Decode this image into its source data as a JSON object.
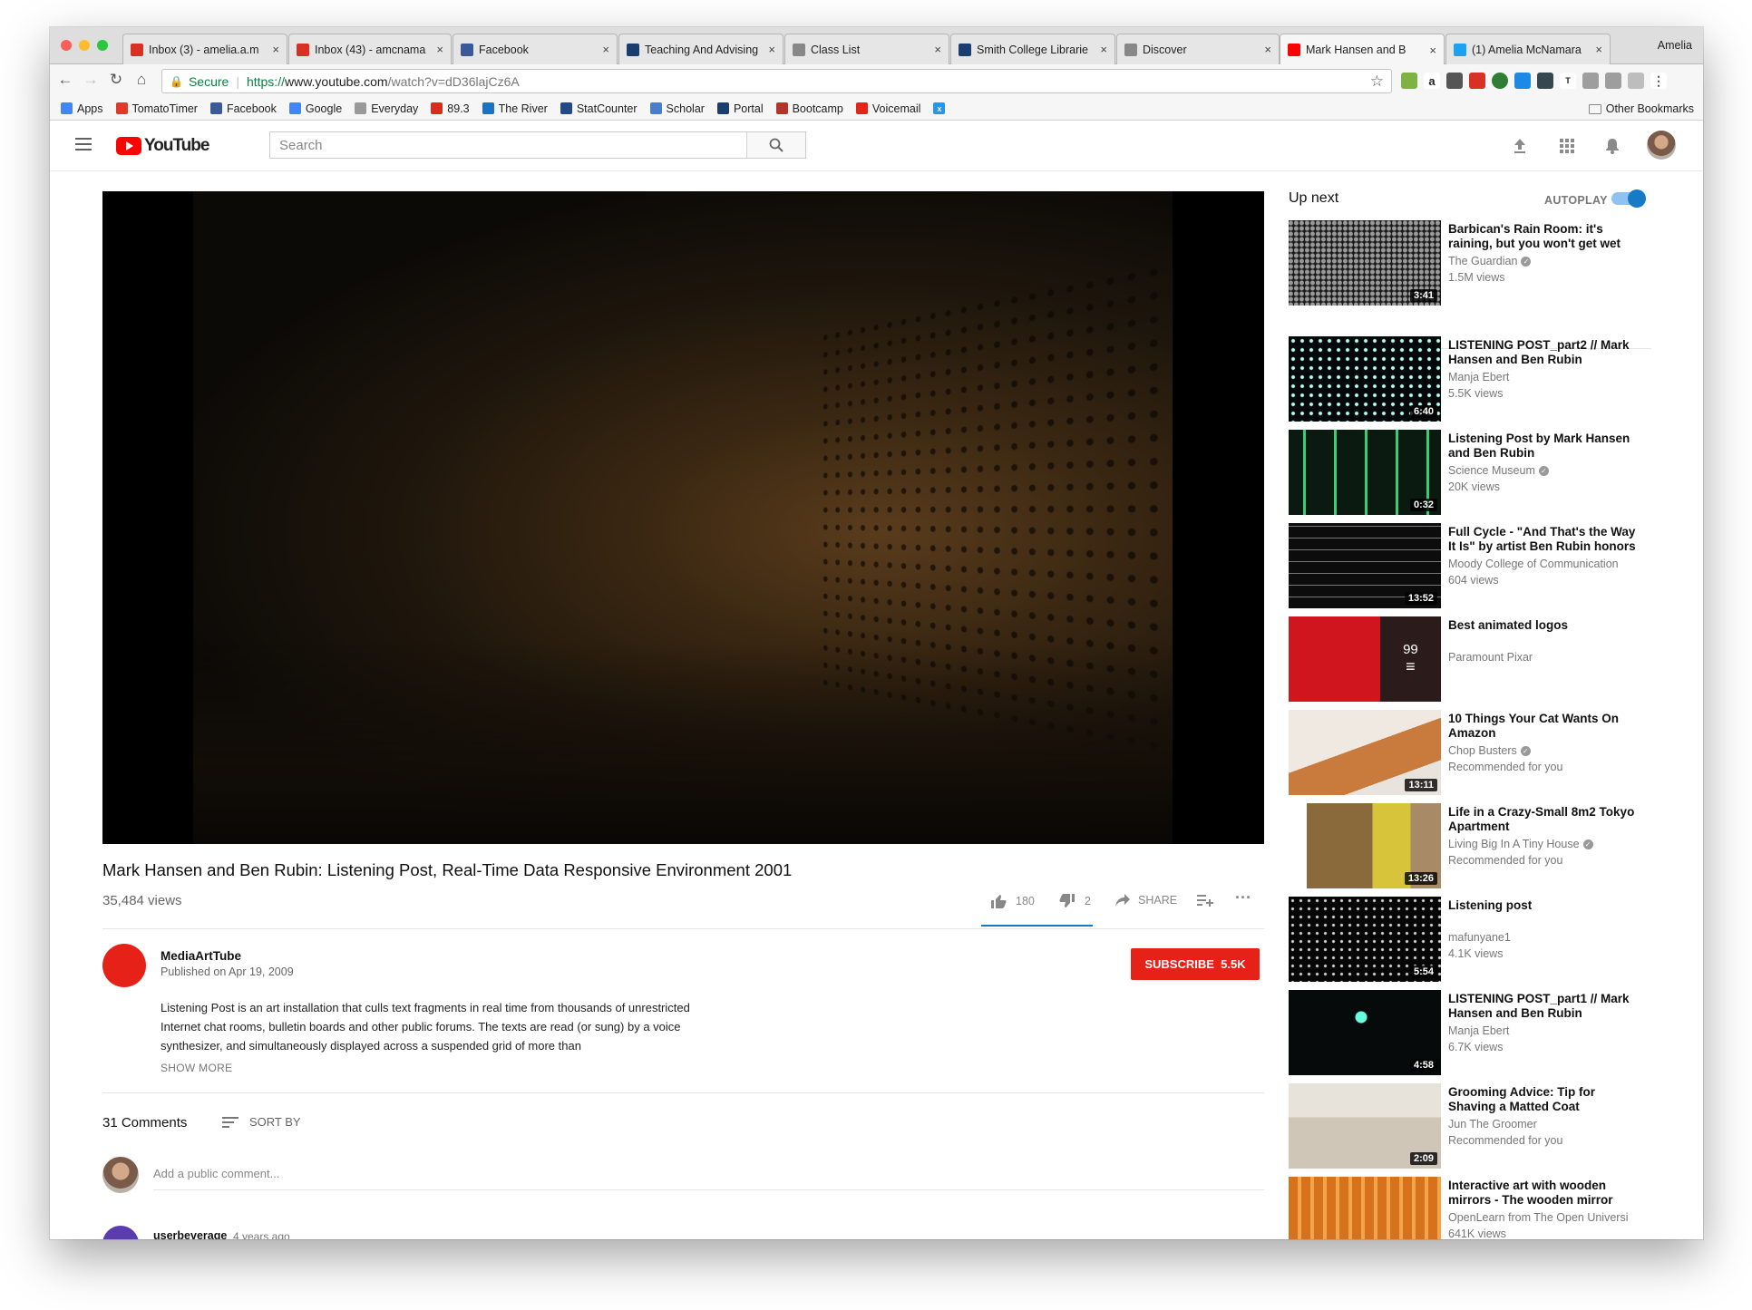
{
  "browser": {
    "profile_name": "Amelia",
    "tabs": [
      {
        "label": "Inbox (3) - amelia.a.m",
        "favicon": "gmail-icon",
        "color": "#d93025"
      },
      {
        "label": "Inbox (43) - amcnama",
        "favicon": "gmail-icon",
        "color": "#d93025"
      },
      {
        "label": "Facebook",
        "favicon": "facebook-icon",
        "color": "#3b5998"
      },
      {
        "label": "Teaching And Advising",
        "favicon": "smith-icon",
        "color": "#1b3e70"
      },
      {
        "label": "Class List",
        "favicon": "page-icon",
        "color": "#888888"
      },
      {
        "label": "Smith College Librarie",
        "favicon": "smith-icon",
        "color": "#1b3e70"
      },
      {
        "label": "Discover",
        "favicon": "page-icon",
        "color": "#888888"
      },
      {
        "label": "Mark Hansen and B",
        "favicon": "youtube-icon",
        "color": "#ff0000",
        "active": true
      },
      {
        "label": "(1) Amelia McNamara",
        "favicon": "twitter-icon",
        "color": "#1da1f2"
      }
    ],
    "secure_label": "Secure",
    "url_scheme": "https://",
    "url_host": "www.youtube.com",
    "url_path": "/watch?v=dD36lajCz6A",
    "bookmarks": [
      {
        "label": "Apps",
        "icon": "apps-icon",
        "color": "#4285f4"
      },
      {
        "label": "TomatoTimer",
        "icon": "tomato-icon",
        "color": "#e0392b"
      },
      {
        "label": "Facebook",
        "icon": "facebook-icon",
        "color": "#3b5998"
      },
      {
        "label": "Google",
        "icon": "google-icon",
        "color": "#4285f4"
      },
      {
        "label": "Everyday",
        "icon": "folder-icon",
        "color": "#999999"
      },
      {
        "label": "89.3",
        "icon": "radio-icon",
        "color": "#d62d20"
      },
      {
        "label": "The River",
        "icon": "river-icon",
        "color": "#1e73be"
      },
      {
        "label": "StatCounter",
        "icon": "statcounter-icon",
        "color": "#234a84"
      },
      {
        "label": "Scholar",
        "icon": "scholar-icon",
        "color": "#4a7ecb"
      },
      {
        "label": "Portal",
        "icon": "smith-icon",
        "color": "#1b3e70"
      },
      {
        "label": "Bootcamp",
        "icon": "bootcamp-icon",
        "color": "#b2352a"
      },
      {
        "label": "Voicemail",
        "icon": "adobe-icon",
        "color": "#e1251b"
      }
    ],
    "other_bookmarks": "Other Bookmarks"
  },
  "youtube": {
    "logo_text": "YouTube",
    "search_placeholder": "Search"
  },
  "video": {
    "title": "Mark Hansen and Ben Rubin: Listening Post, Real-Time Data Responsive Environment 2001",
    "views": "35,484 views",
    "likes": "180",
    "dislikes": "2",
    "share_label": "SHARE",
    "channel": "MediaArtTube",
    "published": "Published on Apr 19, 2009",
    "subscribe_label": "SUBSCRIBE",
    "subscriber_count": "5.5K",
    "description": "Listening Post is an art installation that culls text fragments in real time from thousands of unrestricted Internet chat rooms, bulletin boards and other public forums. The texts are read (or sung) by a voice synthesizer, and simultaneously displayed across a suspended grid of more than",
    "show_more": "SHOW MORE"
  },
  "comments": {
    "count": "31 Comments",
    "sort_label": "SORT BY",
    "placeholder": "Add a public comment...",
    "first": {
      "author": "userbeverage",
      "time": "4 years ago"
    }
  },
  "sidebar": {
    "up_next": "Up next",
    "autoplay": "AUTOPLAY",
    "autoplay_on": true,
    "items": [
      {
        "title": "Barbican's Rain Room: it's raining, but you won't get wet",
        "channel": "The Guardian",
        "verified": true,
        "meta": "1.5M views",
        "duration": "3:41"
      },
      {
        "title": "LISTENING POST_part2 // Mark Hansen and Ben Rubin",
        "channel": "Manja Ebert",
        "verified": false,
        "meta": "5.5K views",
        "duration": "6:40"
      },
      {
        "title": "Listening Post by Mark Hansen and Ben Rubin",
        "channel": "Science Museum",
        "verified": true,
        "meta": "20K views",
        "duration": "0:32"
      },
      {
        "title": "Full Cycle - \"And That's the Way It Is\" by artist Ben Rubin honors",
        "channel": "Moody College of Communication",
        "verified": false,
        "meta": "604 views",
        "duration": "13:52"
      },
      {
        "title": "Best animated logos",
        "channel": "Paramount Pixar",
        "verified": false,
        "meta": "",
        "duration": "",
        "playlist_count": "99"
      },
      {
        "title": "10 Things Your Cat Wants On Amazon",
        "channel": "Chop Busters",
        "verified": true,
        "meta": "Recommended for you",
        "duration": "13:11"
      },
      {
        "title": "Life in a Crazy-Small 8m2 Tokyo Apartment",
        "channel": "Living Big In A Tiny House",
        "verified": true,
        "meta": "Recommended for you",
        "duration": "13:26"
      },
      {
        "title": "Listening post",
        "channel": "mafunyane1",
        "verified": false,
        "meta": "4.1K views",
        "duration": "5:54"
      },
      {
        "title": "LISTENING POST_part1 // Mark Hansen and Ben Rubin",
        "channel": "Manja Ebert",
        "verified": false,
        "meta": "6.7K views",
        "duration": "4:58"
      },
      {
        "title": "Grooming Advice: Tip for Shaving a Matted Coat",
        "channel": "Jun The Groomer",
        "verified": false,
        "meta": "Recommended for you",
        "duration": "2:09"
      },
      {
        "title": "Interactive art with wooden mirrors - The wooden mirror",
        "channel": "OpenLearn from The Open Universi",
        "verified": false,
        "meta": "641K views",
        "duration": ""
      }
    ]
  }
}
